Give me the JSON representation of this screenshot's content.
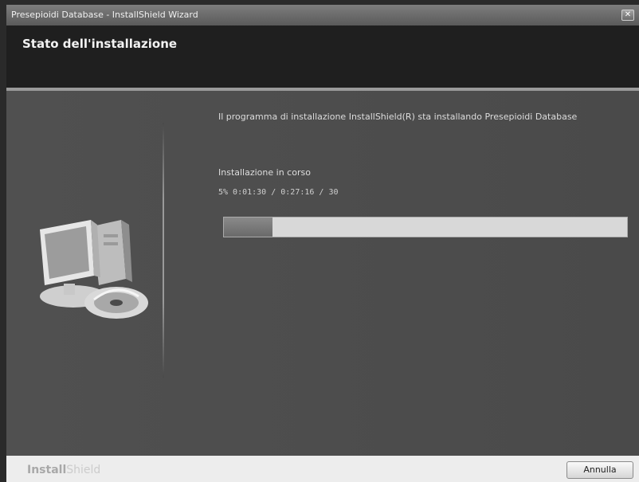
{
  "window": {
    "title": "Presepioidi Database - InstallShield Wizard",
    "close_glyph": "✕"
  },
  "header": {
    "title": "Stato dell'installazione"
  },
  "main": {
    "description": "Il programma di installazione InstallShield(R) sta installando Presepioidi Database",
    "status_label": "Installazione in corso",
    "status_detail": "5%   0:01:30 / 0:27:16 / 30",
    "progress": 0.12
  },
  "footer": {
    "brand_bold": "Install",
    "brand_light": "Shield",
    "cancel_label": "Annulla"
  },
  "colors": {
    "progress_fill": "#7a7a7a",
    "track": "#d8d8d8"
  },
  "icons": {
    "computer": "computer-cd-icon",
    "close": "close-icon"
  }
}
